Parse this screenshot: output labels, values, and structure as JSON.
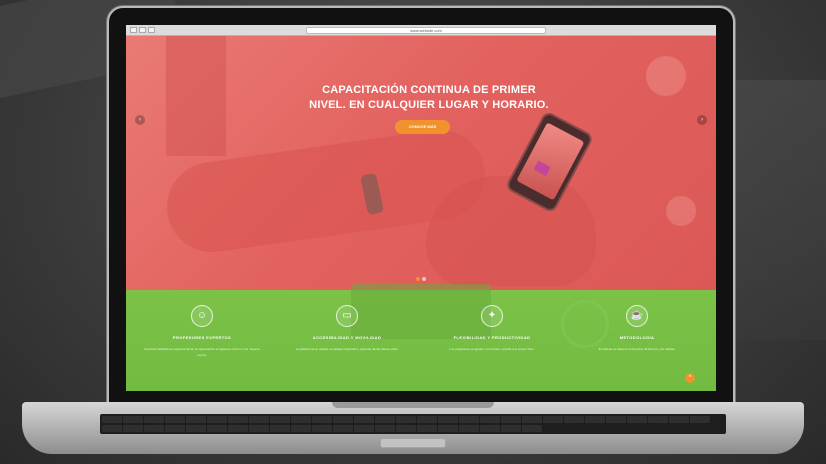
{
  "browser": {
    "url": "www.website.com"
  },
  "hero": {
    "title_line1": "CAPACITACIÓN CONTINUA DE PRIMER",
    "title_line2": "NIVEL. EN CUALQUIER LUGAR Y HORARIO.",
    "cta_label": "CONOCE MÁS",
    "prev_arrow": "‹",
    "next_arrow": "›",
    "slide_count": 2,
    "active_slide": 1
  },
  "features": [
    {
      "icon": "teacher-icon",
      "glyph": "☺",
      "title": "PROFESORES EXPERTOS",
      "text": "Nuestros facilitadores expertos llevan la capacitación al siguiente nivel con los mejores cursos."
    },
    {
      "icon": "devices-icon",
      "glyph": "▭",
      "title": "ACCESIBILIDAD Y MOVILIDAD",
      "text": "La plataforma se adapta a cualquier dispositivo, aprende desde donde estés."
    },
    {
      "icon": "lightbulb-icon",
      "glyph": "✦",
      "title": "FLEXIBILIDAD Y PRODUCTIVIDAD",
      "text": "Los programas se ajustan a tu horario, estudia a tu propio ritmo."
    },
    {
      "icon": "coffee-icon",
      "glyph": "☕",
      "title": "METODOLOGÍA",
      "text": "El método se basa en contenidos dinámicos y de calidad."
    }
  ],
  "scroll_top_glyph": "^",
  "colors": {
    "hero_overlay": "#e36b68",
    "features_bg": "#78bf44",
    "accent": "#f0922e"
  }
}
